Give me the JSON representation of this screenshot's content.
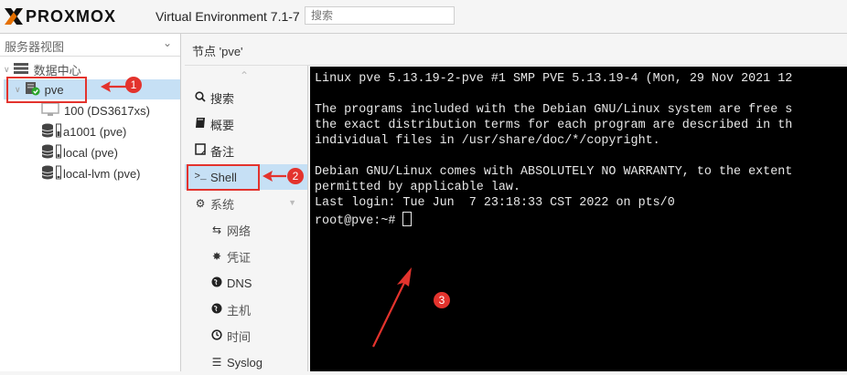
{
  "header": {
    "brand": "PROXMOX",
    "version": "Virtual Environment 7.1-7",
    "search_placeholder": "搜索"
  },
  "tree": {
    "view_label": "服务器视图",
    "datacenter": "数据中心",
    "node": "pve",
    "vm": "100 (DS3617xs)",
    "storages": [
      "a1001 (pve)",
      "local (pve)",
      "local-lvm (pve)"
    ]
  },
  "node_title": "节点 'pve'",
  "nav": {
    "search": "搜索",
    "summary": "概要",
    "notes": "备注",
    "shell": "Shell",
    "system": "系统",
    "network": "网络",
    "certificates": "凭证",
    "dns": "DNS",
    "hosts": "主机",
    "time": "时间",
    "syslog": "Syslog"
  },
  "terminal": {
    "lines": [
      "Linux pve 5.13.19-2-pve #1 SMP PVE 5.13.19-4 (Mon, 29 Nov 2021 12",
      "",
      "The programs included with the Debian GNU/Linux system are free s",
      "the exact distribution terms for each program are described in th",
      "individual files in /usr/share/doc/*/copyright.",
      "",
      "Debian GNU/Linux comes with ABSOLUTELY NO WARRANTY, to the extent",
      "permitted by applicable law.",
      "Last login: Tue Jun  7 23:18:33 CST 2022 on pts/0"
    ],
    "prompt": "root@pve:~# "
  },
  "annotations": {
    "badge1": "1",
    "badge2": "2",
    "badge3": "3",
    "accent": "#e3332d"
  },
  "colors": {
    "selection": "#c6e0f5",
    "terminal_bg": "#000000",
    "status_ok": "#2aa52a"
  }
}
